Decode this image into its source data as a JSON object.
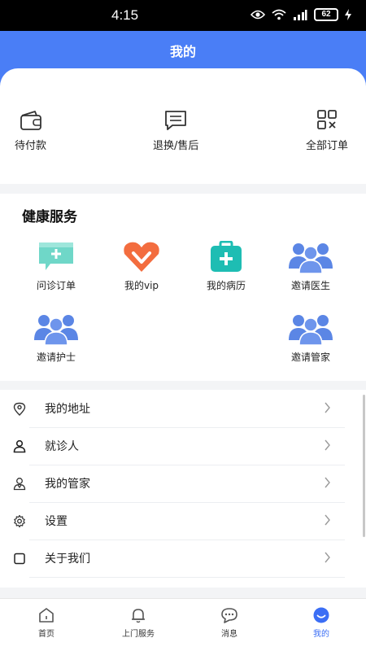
{
  "status_bar": {
    "time": "4:15",
    "battery": "62"
  },
  "header": {
    "title": "我的"
  },
  "orders": [
    {
      "label": "待付款",
      "icon": "wallet-icon"
    },
    {
      "label": "退换/售后",
      "icon": "chat-icon"
    },
    {
      "label": "全部订单",
      "icon": "grid-icon"
    }
  ],
  "health": {
    "title": "健康服务",
    "items": [
      {
        "label": "问诊订单",
        "icon": "consult-icon"
      },
      {
        "label": "我的vip",
        "icon": "vip-heart-icon"
      },
      {
        "label": "我的病历",
        "icon": "medical-kit-icon"
      },
      {
        "label": "邀请医生",
        "icon": "group-icon"
      },
      {
        "label": "邀请护士",
        "icon": "group-icon"
      },
      {
        "label": "邀请管家",
        "icon": "group-icon"
      }
    ]
  },
  "menu": [
    {
      "label": "我的地址",
      "icon": "location-icon"
    },
    {
      "label": "就诊人",
      "icon": "person-icon"
    },
    {
      "label": "我的管家",
      "icon": "butler-icon"
    },
    {
      "label": "设置",
      "icon": "gear-icon"
    },
    {
      "label": "关于我们",
      "icon": "square-icon"
    }
  ],
  "tabs": [
    {
      "label": "首页",
      "icon": "home-icon",
      "active": false
    },
    {
      "label": "上门服务",
      "icon": "bell-icon",
      "active": false
    },
    {
      "label": "消息",
      "icon": "message-icon",
      "active": false
    },
    {
      "label": "我的",
      "icon": "profile-icon",
      "active": true
    }
  ],
  "colors": {
    "primary": "#4a7ef6",
    "active_tab": "#3b6ef5",
    "background": "#f3f4f6"
  }
}
